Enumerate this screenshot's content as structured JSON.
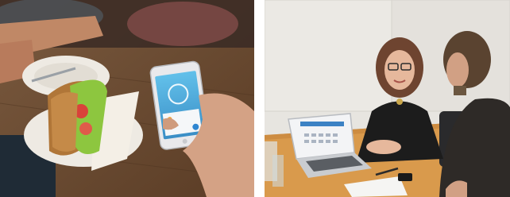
{
  "images": [
    {
      "id": "photo-left",
      "subject": "phone-app-over-food",
      "colors": {
        "table": "#6b4a31",
        "phone_screen": "#4fa9d9",
        "lettuce": "#8dc63f",
        "plate": "#eeeae3"
      }
    },
    {
      "id": "photo-right",
      "subject": "meeting-with-laptop",
      "colors": {
        "wall": "#e7e5e0",
        "desk": "#d99a4c",
        "sweater": "#1c1c1c",
        "laptop": "#c9ccd0"
      }
    }
  ]
}
